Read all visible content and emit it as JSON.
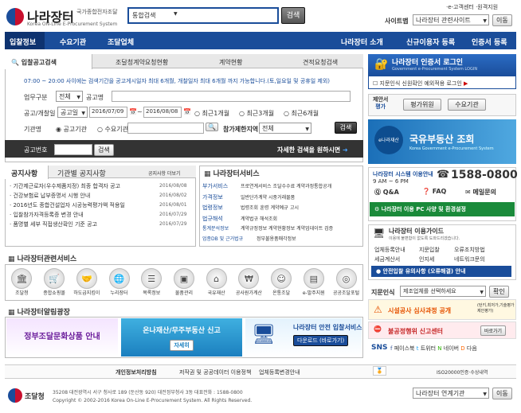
{
  "header": {
    "logo_main": "나라장터",
    "logo_sub1": "국가종합전자조달",
    "logo_sub2": "Korea ON-Line E-Procurement System",
    "search_scope": "통합검색",
    "search_button": "검색",
    "top_links": [
      "·e-고객센터",
      "·원격지원"
    ],
    "sitemap_label": "사이트맵",
    "sitemap_select": "나라장터 관련사이트",
    "go_button": "이동"
  },
  "nav": {
    "left": [
      "입찰정보",
      "수요기관",
      "조달업체"
    ],
    "right": [
      "나라장터 소개",
      "신규이용자 등록",
      "인증서 등록"
    ]
  },
  "search_panel": {
    "tabs": [
      "입찰공고검색",
      "조달청계약요청현황",
      "계약현황",
      "견적요청검색"
    ],
    "notice": "07:00 ~ 20:00 사이에는 검색기간을 공고게시일자 최대 6개월, 개찰일자 최대 6개월 까지 가능합니다.(토,일요일 및 공휴일 제외)",
    "biz_label": "업무구분",
    "biz_value": "전체",
    "name_label": "공고명",
    "date_label": "공고/개찰일",
    "date_type": "공고일",
    "date_from": "2016/07/09",
    "date_to": "2016/08/08",
    "recent": [
      "최근1개월",
      "최근3개월",
      "최근6개월"
    ],
    "agency_label": "기관명",
    "agency_opts": [
      "공고기관",
      "수요기관"
    ],
    "region_label": "참가제한지역",
    "region_value": "전체",
    "search_btn": "검색",
    "bid_no_label": "공고번호",
    "bid_no_btn": "검색",
    "detail_link": "자세한 검색을 원하시면"
  },
  "notices": {
    "tabs": [
      "공지사항",
      "기관별 공지사항"
    ],
    "more": "공지사항 더보기",
    "items": [
      {
        "t": "기간제근로자(우수제품지정) 최종 합격자 공고",
        "d": "2016/08/08"
      },
      {
        "t": "건강보험료 납부증명서 시행 안내",
        "d": "2016/08/02"
      },
      {
        "t": "2016년도 종합건설업자 시공능력평가액 적용일",
        "d": "2016/08/01"
      },
      {
        "t": "입찰참가자격등록증 변경 안내",
        "d": "2016/07/29"
      },
      {
        "t": "품명별 세부 직접생산확인 기준 공고",
        "d": "2016/07/29"
      }
    ]
  },
  "services": {
    "title": "나라장터서비스",
    "rows": [
      [
        "부가서비스",
        "프로연계서비스 조달수수료 계약과정통합공개"
      ],
      [
        "가격정보",
        "일반단가계약 시중거래물품"
      ],
      [
        "법령정보",
        "법령조회",
        "훈령",
        "계약예규",
        "고시"
      ],
      [
        "법규해석",
        "계약법규 해석조회"
      ],
      [
        "통계분석정보",
        "계약규정정보",
        "계약현황정보",
        "계약업데이트 검증"
      ],
      [
        "업종DB 및 근거법규",
        "정부불용품매각정보"
      ]
    ]
  },
  "related": {
    "title": "나라장터관련서비스",
    "items": [
      "조달청",
      "종합쇼핑몰",
      "하도급지킴이",
      "누리장터",
      "목록정보",
      "물품관리",
      "국유재산",
      "공사원가계산",
      "온통조달",
      "e-발주지원",
      "공공조달포털"
    ]
  },
  "banner": {
    "title": "나라장터알림광장",
    "b1": "정부조달문화상품 안내",
    "b2": "온나재산/무주부동산 신고",
    "b2_btn": "자세히",
    "b3_title": "나라장터 안전 입찰서비스",
    "b3_btn": "다운로드 (바로가기)"
  },
  "right": {
    "login_title": "나라장터 인증서 로그인",
    "login_sub": "Government e-Procurement System LOGIN",
    "fingerprint": "지문인식 신원확인 예외적용 로그인",
    "proposal": [
      "제안서",
      "평가"
    ],
    "eval": [
      "평가위원",
      "수요기관"
    ],
    "ad_brand": "e나라재산",
    "ad_text": "국유부동산 조회",
    "ad_sub": "Korea Government e-Procurement System",
    "hours_title": "나라장터 시스템 이용안내",
    "hours": "9 AM ~ 6 PM",
    "phone": "1588-0800",
    "qna": "Q&A",
    "faq": "FAQ",
    "mail": "메일문의",
    "env": "나라장터 이용 PC 사양 및 환경설정",
    "guide_title": "나라장터 이용가이드",
    "guide_sub": "이용에 불편함이 없도록 도와드리겠습니다.",
    "guide_links": [
      "업체등록안내",
      "지문입찰",
      "오류조치방법",
      "세금계산서",
      "인지세",
      "네트워크문의"
    ],
    "safe_btn": "안전입찰 유의사항 (오류해결) 안내",
    "fingerprint_label": "지문인식",
    "fingerprint_select": "제조업체를 선택하세요",
    "fp_btn": "확인",
    "facility": "시설공사 심사과정 공개",
    "facility_sub": "(턴키,최저가,기술평가 제안평가)",
    "report": "불공정행위 신고센터",
    "report_btn": "바로가기",
    "sns": "SNS",
    "sns_items": [
      "페이스북",
      "트위터",
      "네이버",
      "다음"
    ],
    "iso": "ISO20000인증·수상내역"
  },
  "footer": {
    "links": [
      "개인정보처리방침",
      "저작권 및 공공데이터 이용정책",
      "업체등록변경안내"
    ],
    "org": "조달청",
    "address": "35208 대전광역시 서구 청사로 189 (둔산동 920) 대전정부청사 3동 대표전화 : 1588-0800",
    "copyright": "Copyright © 2002-2016 Korea On-Line E-Procurement System. All Rights Reserved.",
    "select": "나라장터 연계기관",
    "go": "이동"
  }
}
